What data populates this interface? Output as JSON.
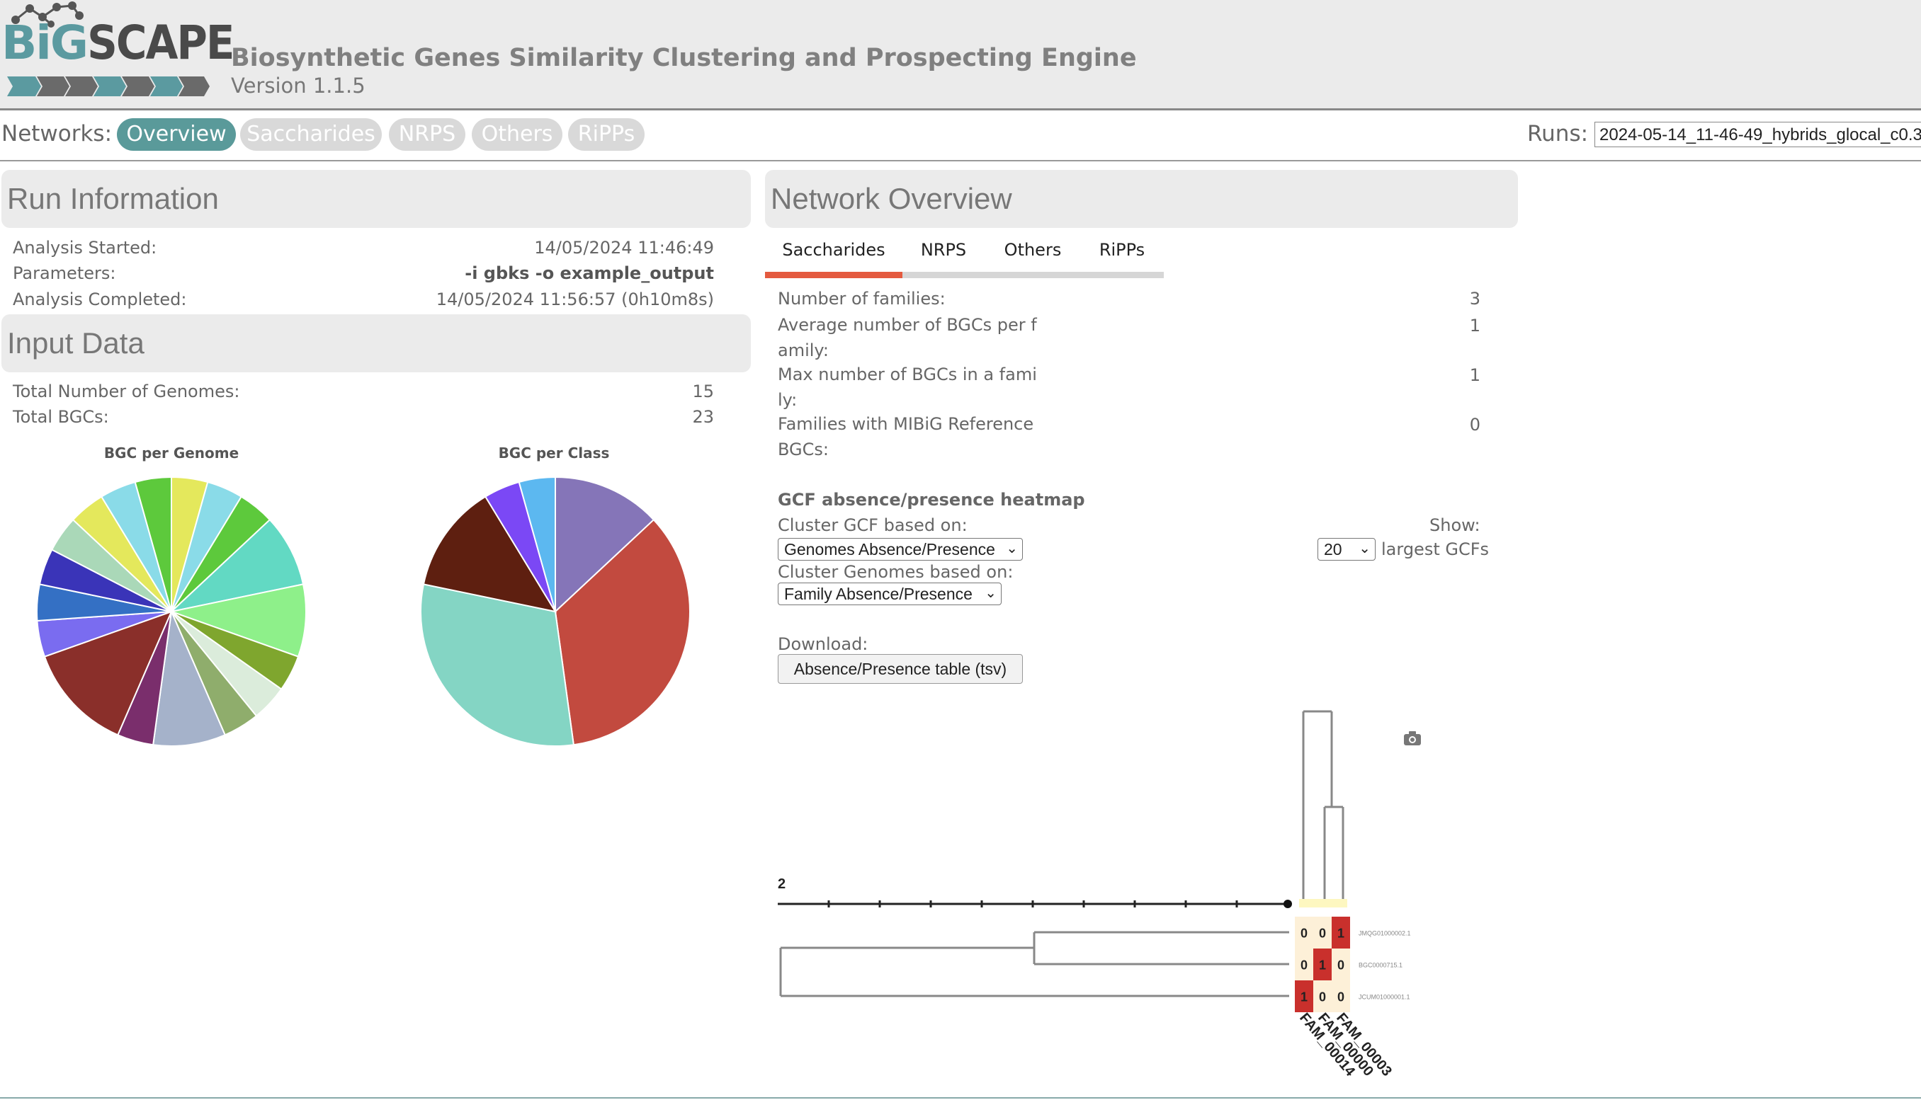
{
  "header": {
    "logo_big": "BiG",
    "logo_scape": "SCAPE",
    "title": "Biosynthetic Genes Similarity Clustering and Prospecting Engine",
    "version": "Version 1.1.5"
  },
  "nav": {
    "networks_label": "Networks:",
    "tabs": [
      "Overview",
      "Saccharides",
      "NRPS",
      "Others",
      "RiPPs"
    ],
    "active": "Overview",
    "runs_label": "Runs:",
    "run_value": "2024-05-14_11-46-49_hybrids_glocal_c0.3"
  },
  "run_info": {
    "title": "Run Information",
    "rows": [
      {
        "label": "Analysis Started:",
        "value": "14/05/2024 11:46:49"
      },
      {
        "label": "Parameters:",
        "value": "-i gbks -o example_output"
      },
      {
        "label": "Analysis Completed:",
        "value": "14/05/2024 11:56:57 (0h10m8s)"
      }
    ]
  },
  "input_data": {
    "title": "Input Data",
    "rows": [
      {
        "label": "Total Number of Genomes:",
        "value": "15"
      },
      {
        "label": "Total BGCs:",
        "value": "23"
      }
    ]
  },
  "chart_data": [
    {
      "type": "pie",
      "title": "BGC per Genome",
      "values": [
        1,
        1,
        1,
        2,
        2,
        1,
        1,
        1,
        2,
        1,
        3,
        1,
        1,
        1,
        1,
        1,
        1,
        1
      ],
      "colors": [
        "#e4e85c",
        "#8adbe8",
        "#5dc93c",
        "#62d9c3",
        "#8ef08a",
        "#7fa62e",
        "#dbecdb",
        "#8fad6c",
        "#a5b2ca",
        "#7a2e6c",
        "#8a2f2a",
        "#7a6cf0",
        "#3470c4",
        "#3a34b8",
        "#aad8b8"
      ]
    },
    {
      "type": "pie",
      "title": "BGC per Class",
      "values": [
        3,
        8,
        7,
        3,
        1,
        1
      ],
      "colors": [
        "#8575b8",
        "#c24a3f",
        "#84d5c4",
        "#5e1f10",
        "#7b48f5",
        "#5cb8f0"
      ]
    }
  ],
  "network_overview": {
    "title": "Network Overview",
    "tabs": [
      "Saccharides",
      "NRPS",
      "Others",
      "RiPPs"
    ],
    "active_tab": "Saccharides",
    "stats": [
      {
        "label_lines": [
          "Number of families:"
        ],
        "value": "3"
      },
      {
        "label_lines": [
          "Average number of BGCs per f",
          "amily:"
        ],
        "value": "1"
      },
      {
        "label_lines": [
          "Max number of BGCs in a fami",
          "ly:"
        ],
        "value": "1"
      },
      {
        "label_lines": [
          "Families with MIBiG Reference",
          "BGCs:"
        ],
        "value": "0"
      }
    ],
    "heatmap_title": "GCF absence/presence heatmap",
    "cluster_gcf_label": "Cluster GCF based on:",
    "cluster_gcf_value": "Genomes Absence/Presence",
    "show_label": "Show:",
    "show_value": "20",
    "show_suffix": "largest GCFs",
    "cluster_genomes_label": "Cluster Genomes based on:",
    "cluster_genomes_value": "Family Absence/Presence",
    "download_label": "Download:",
    "download_button": "Absence/Presence table (tsv)"
  },
  "heatmap": {
    "scale_label": "2",
    "rows": [
      {
        "name": "JMQG01000002.1",
        "cells": [
          "0",
          "0",
          "1"
        ]
      },
      {
        "name": "BGC0000715.1",
        "cells": [
          "0",
          "1",
          "0"
        ]
      },
      {
        "name": "JCUM01000001.1",
        "cells": [
          "1",
          "0",
          "0"
        ]
      }
    ],
    "columns": [
      "FAM_00014",
      "FAM_00000",
      "FAM_00003"
    ],
    "present_color": "#c9302c",
    "absent_color": "#fdf0d8"
  }
}
